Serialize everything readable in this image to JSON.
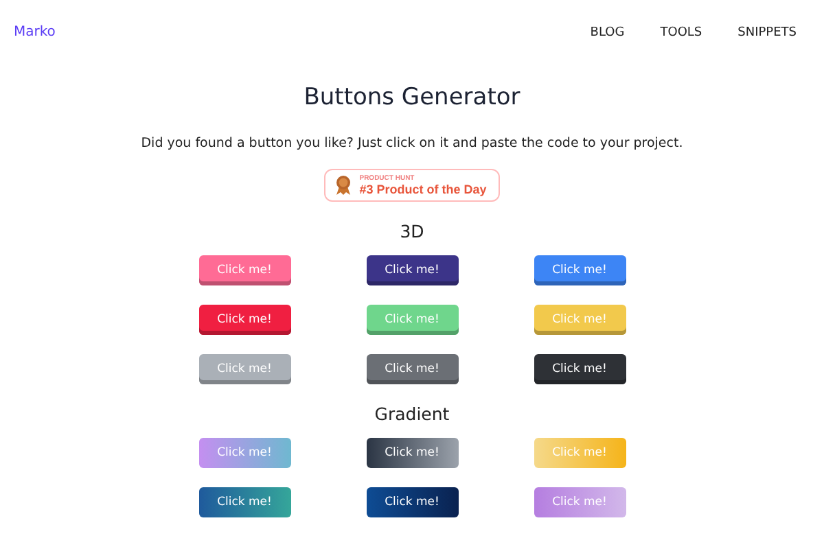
{
  "nav": {
    "brand": "Marko",
    "links": [
      "BLOG",
      "TOOLS",
      "SNIPPETS"
    ]
  },
  "title": "Buttons Generator",
  "subtitle": "Did you found a button you like? Just click on it and paste the code to your project.",
  "badge": {
    "kicker": "PRODUCT HUNT",
    "text": "#3 Product of the Day"
  },
  "sections": [
    {
      "heading": "3D",
      "kind": "solid",
      "buttons": [
        {
          "label": "Click me!",
          "color": "#ff6b95"
        },
        {
          "label": "Click me!",
          "color": "#3c3489"
        },
        {
          "label": "Click me!",
          "color": "#3d85f5"
        },
        {
          "label": "Click me!",
          "color": "#f01f41"
        },
        {
          "label": "Click me!",
          "color": "#6fd68c"
        },
        {
          "label": "Click me!",
          "color": "#f2c94c"
        },
        {
          "label": "Click me!",
          "color": "#aab0b7"
        },
        {
          "label": "Click me!",
          "color": "#6b6f75"
        },
        {
          "label": "Click me!",
          "color": "#2e3136"
        }
      ]
    },
    {
      "heading": "Gradient",
      "kind": "gradient",
      "buttons": [
        {
          "label": "Click me!",
          "stops": [
            {
              "color": "#c48ff0"
            },
            {
              "color": "#6fb8d0"
            }
          ]
        },
        {
          "label": "Click me!",
          "stops": [
            {
              "color": "#2b3544"
            },
            {
              "color": "#9ba2ab"
            }
          ]
        },
        {
          "label": "Click me!",
          "stops": [
            {
              "color": "#f5d98a"
            },
            {
              "color": "#f5b41a"
            }
          ]
        },
        {
          "label": "Click me!",
          "stops": [
            {
              "color": "#1f5a9c"
            },
            {
              "color": "#35a69a"
            }
          ]
        },
        {
          "label": "Click me!",
          "stops": [
            {
              "color": "#0e4c94"
            },
            {
              "color": "#0a2250"
            }
          ]
        },
        {
          "label": "Click me!",
          "stops": [
            {
              "color": "#b57ee0"
            },
            {
              "color": "#d2b8ea"
            }
          ]
        }
      ]
    }
  ]
}
